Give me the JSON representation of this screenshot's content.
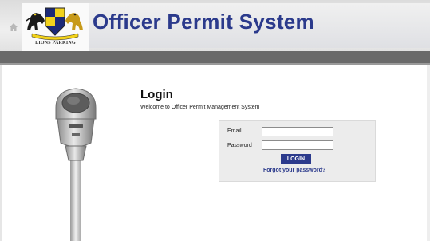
{
  "header": {
    "app_title": "Officer Permit System",
    "logo_caption": "LIONS PARKING",
    "home_icon": "home-icon"
  },
  "login": {
    "title": "Login",
    "welcome": "Welcome to Officer Permit Management System",
    "email_label": "Email",
    "email_value": "",
    "password_label": "Password",
    "password_value": "",
    "button_label": "LOGIN",
    "forgot_link": "Forgot your password?"
  },
  "colors": {
    "brand_blue": "#2b3a8c",
    "header_bar": "#6a6a6a",
    "panel_bg": "#ececec"
  }
}
